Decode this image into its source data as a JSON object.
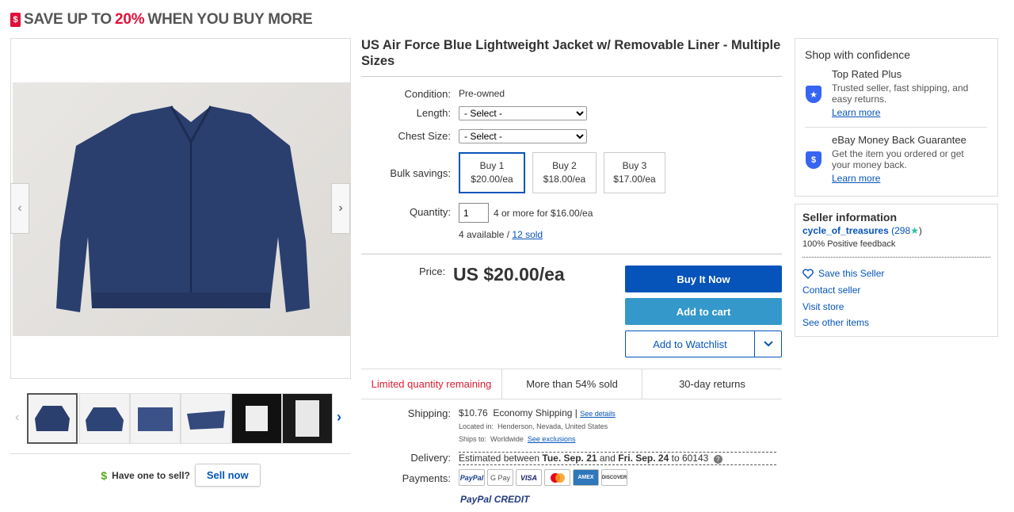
{
  "promo": {
    "pre": "SAVE UP TO ",
    "pct": "20%",
    "post": " WHEN YOU BUY MORE",
    "tag_icon": "$"
  },
  "title": "US Air Force Blue Lightweight Jacket w/ Removable Liner - Multiple Sizes",
  "details": {
    "condition_label": "Condition:",
    "condition_value": "Pre-owned",
    "length_label": "Length:",
    "length_value": "- Select -",
    "chest_label": "Chest Size:",
    "chest_value": "- Select -",
    "bulk_label": "Bulk savings:",
    "bulk": [
      {
        "qty": "Buy 1",
        "price": "$20.00/ea"
      },
      {
        "qty": "Buy 2",
        "price": "$18.00/ea"
      },
      {
        "qty": "Buy 3",
        "price": "$17.00/ea"
      }
    ],
    "quantity_label": "Quantity:",
    "quantity_value": "1",
    "quantity_deal": "4 or more for $16.00/ea",
    "available": "4 available / ",
    "sold": "12 sold"
  },
  "price": {
    "label": "Price:",
    "value": "US $20.00/ea"
  },
  "buttons": {
    "buy": "Buy It Now",
    "cart": "Add to cart",
    "watch": "Add to Watchlist"
  },
  "stats": [
    "Limited quantity remaining",
    "More than 54% sold",
    "30-day returns"
  ],
  "shipping": {
    "label": "Shipping:",
    "cost": "$10.76",
    "method": "Economy Shipping",
    "sep": "|",
    "details": "See details",
    "located_label": "Located in:",
    "located": "Henderson, Nevada, United States",
    "ships_label": "Ships to:",
    "ships": "Worldwide",
    "exclusions": "See exclusions"
  },
  "delivery": {
    "label": "Delivery:",
    "pre": "Estimated between ",
    "d1": "Tue. Sep. 21",
    "mid": " and ",
    "d2": "Fri. Sep. 24",
    "post": " to 60143"
  },
  "payments": {
    "label": "Payments:",
    "logos": [
      "PayPal",
      "G Pay",
      "VISA",
      "MC",
      "AMEX",
      "DISCOVER"
    ],
    "credit": "PayPal CREDIT"
  },
  "sell": {
    "text": "Have one to sell?",
    "button": "Sell now"
  },
  "confidence": {
    "heading": "Shop with confidence",
    "items": [
      {
        "title": "Top Rated Plus",
        "desc": "Trusted seller, fast shipping, and easy returns.",
        "link": "Learn more"
      },
      {
        "title": "eBay Money Back Guarantee",
        "desc": "Get the item you ordered or get your money back.",
        "link": "Learn more"
      }
    ]
  },
  "seller": {
    "heading": "Seller information",
    "name": "cycle_of_treasures",
    "score": "(298",
    "score_close": ")",
    "feedback": "100% Positive feedback",
    "links": [
      "Save this Seller",
      "Contact seller",
      "Visit store",
      "See other items"
    ]
  },
  "colors": {
    "accent": "#0654ba",
    "cart": "#3498ca",
    "alert": "#dd1e31",
    "promo": "#e0103a"
  }
}
